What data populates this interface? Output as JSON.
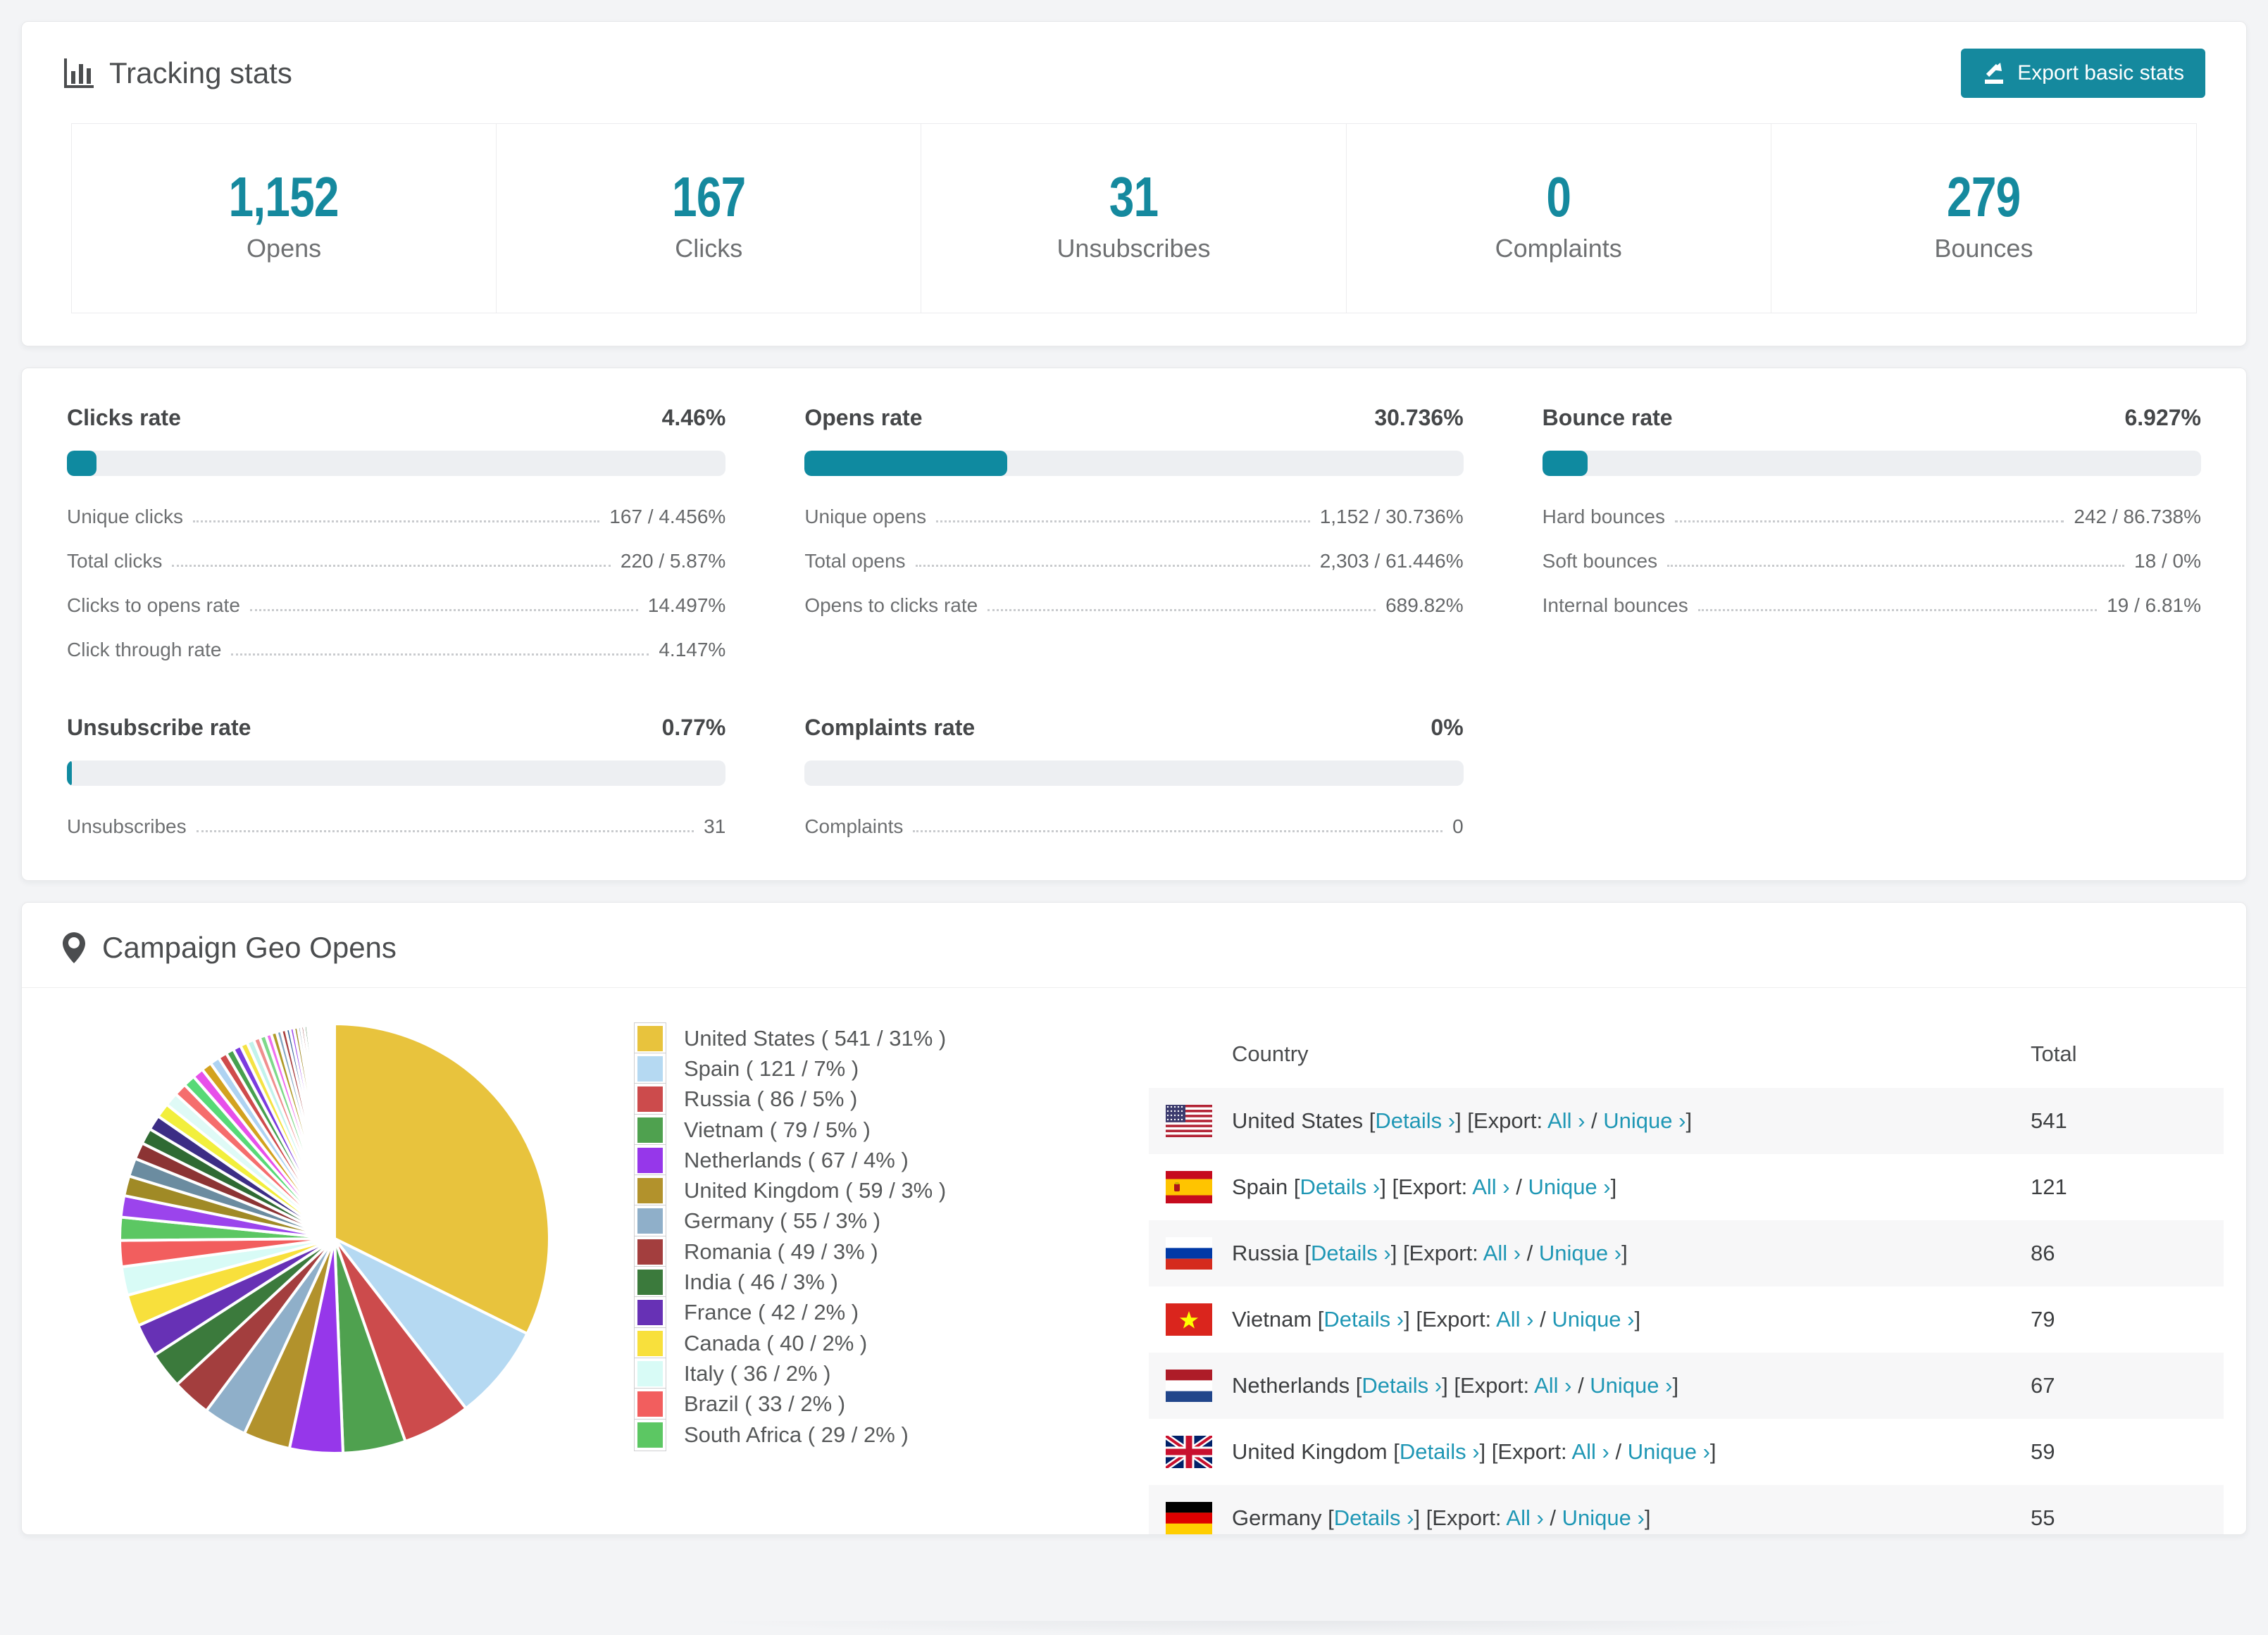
{
  "page": {
    "background": "#f3f4f6",
    "accent": "#15899e",
    "link_color": "#1f97b5"
  },
  "tracking": {
    "title": "Tracking stats",
    "export_label": "Export basic stats",
    "stats": [
      {
        "value": "1,152",
        "label": "Opens"
      },
      {
        "value": "167",
        "label": "Clicks"
      },
      {
        "value": "31",
        "label": "Unsubscribes"
      },
      {
        "value": "0",
        "label": "Complaints"
      },
      {
        "value": "279",
        "label": "Bounces"
      }
    ]
  },
  "rates": [
    {
      "title": "Clicks rate",
      "value": "4.46%",
      "percent": 4.46,
      "rows": [
        {
          "label": "Unique clicks",
          "value": "167 / 4.456%"
        },
        {
          "label": "Total clicks",
          "value": "220 / 5.87%"
        },
        {
          "label": "Clicks to opens rate",
          "value": "14.497%"
        },
        {
          "label": "Click through rate",
          "value": "4.147%"
        }
      ]
    },
    {
      "title": "Opens rate",
      "value": "30.736%",
      "percent": 30.736,
      "rows": [
        {
          "label": "Unique opens",
          "value": "1,152 / 30.736%"
        },
        {
          "label": "Total opens",
          "value": "2,303 / 61.446%"
        },
        {
          "label": "Opens to clicks rate",
          "value": "689.82%"
        }
      ]
    },
    {
      "title": "Bounce rate",
      "value": "6.927%",
      "percent": 6.927,
      "rows": [
        {
          "label": "Hard bounces",
          "value": "242 / 86.738%"
        },
        {
          "label": "Soft bounces",
          "value": "18 / 0%"
        },
        {
          "label": "Internal bounces",
          "value": "19 / 6.81%"
        }
      ]
    },
    {
      "title": "Unsubscribe rate",
      "value": "0.77%",
      "percent": 0.77,
      "rows": [
        {
          "label": "Unsubscribes",
          "value": "31"
        }
      ]
    },
    {
      "title": "Complaints rate",
      "value": "0%",
      "percent": 0,
      "rows": [
        {
          "label": "Complaints",
          "value": "0"
        }
      ]
    }
  ],
  "geo": {
    "title": "Campaign Geo Opens",
    "table": {
      "headers": [
        "Country",
        "Total"
      ],
      "links": {
        "details": "Details",
        "all": "All",
        "unique": "Unique",
        "export_prefix": "Export:",
        "chevron": "›"
      },
      "rows": [
        {
          "country": "United States",
          "flag": "us",
          "total": "541"
        },
        {
          "country": "Spain",
          "flag": "es",
          "total": "121"
        },
        {
          "country": "Russia",
          "flag": "ru",
          "total": "86"
        },
        {
          "country": "Vietnam",
          "flag": "vn",
          "total": "79"
        },
        {
          "country": "Netherlands",
          "flag": "nl",
          "total": "67"
        },
        {
          "country": "United Kingdom",
          "flag": "gb",
          "total": "59"
        },
        {
          "country": "Germany",
          "flag": "de",
          "total": "55"
        }
      ]
    },
    "chart_data": {
      "type": "pie",
      "title": "Campaign Geo Opens",
      "legend_position": "right",
      "start_angle_deg": 0,
      "direction": "clockwise",
      "slices": [
        {
          "label": "United States",
          "value": 541,
          "pct": 31,
          "color": "#e8c33d"
        },
        {
          "label": "Spain",
          "value": 121,
          "pct": 7,
          "color": "#b5d9f2"
        },
        {
          "label": "Russia",
          "value": 86,
          "pct": 5,
          "color": "#cc4b4c"
        },
        {
          "label": "Vietnam",
          "value": 79,
          "pct": 5,
          "color": "#4fa14f"
        },
        {
          "label": "Netherlands",
          "value": 67,
          "pct": 4,
          "color": "#9637ea"
        },
        {
          "label": "United Kingdom",
          "value": 59,
          "pct": 3,
          "color": "#b2922c"
        },
        {
          "label": "Germany",
          "value": 55,
          "pct": 3,
          "color": "#8fafc9"
        },
        {
          "label": "Romania",
          "value": 49,
          "pct": 3,
          "color": "#a33e3e"
        },
        {
          "label": "India",
          "value": 46,
          "pct": 3,
          "color": "#3b7a3c"
        },
        {
          "label": "France",
          "value": 42,
          "pct": 2,
          "color": "#6731b5"
        },
        {
          "label": "Canada",
          "value": 40,
          "pct": 2,
          "color": "#f8e03c"
        },
        {
          "label": "Italy",
          "value": 36,
          "pct": 2,
          "color": "#d8fbf6"
        },
        {
          "label": "Brazil",
          "value": 33,
          "pct": 2,
          "color": "#f25e5e"
        },
        {
          "label": "South Africa",
          "value": 29,
          "pct": 2,
          "color": "#5cc763"
        }
      ],
      "others": {
        "values": [
          27,
          25,
          23,
          21,
          20,
          19,
          18,
          17,
          16,
          15,
          14,
          13,
          12,
          11,
          10,
          10,
          9,
          9,
          8,
          8,
          7,
          7,
          6,
          6,
          5,
          5,
          5,
          4,
          4,
          4,
          3,
          3,
          3,
          3,
          2,
          2,
          2,
          2,
          2,
          2,
          1,
          1,
          1,
          1,
          1,
          1,
          1,
          1,
          1,
          1
        ],
        "palette": [
          "#9b44ec",
          "#a08a26",
          "#6b8ca0",
          "#8c3434",
          "#2f6a33",
          "#3c2d85",
          "#f2ef3d",
          "#dffaf6",
          "#f56d6d",
          "#58d977",
          "#e750ea",
          "#d3a21f",
          "#aed3f2",
          "#cf4b4c",
          "#47a04f",
          "#7b3bdf",
          "#f5e344",
          "#c2f3ec",
          "#f08f8f",
          "#7fd98a",
          "#ef6ff0",
          "#b09a28",
          "#84a8c4",
          "#a84040",
          "#2c5c93"
        ]
      }
    }
  }
}
